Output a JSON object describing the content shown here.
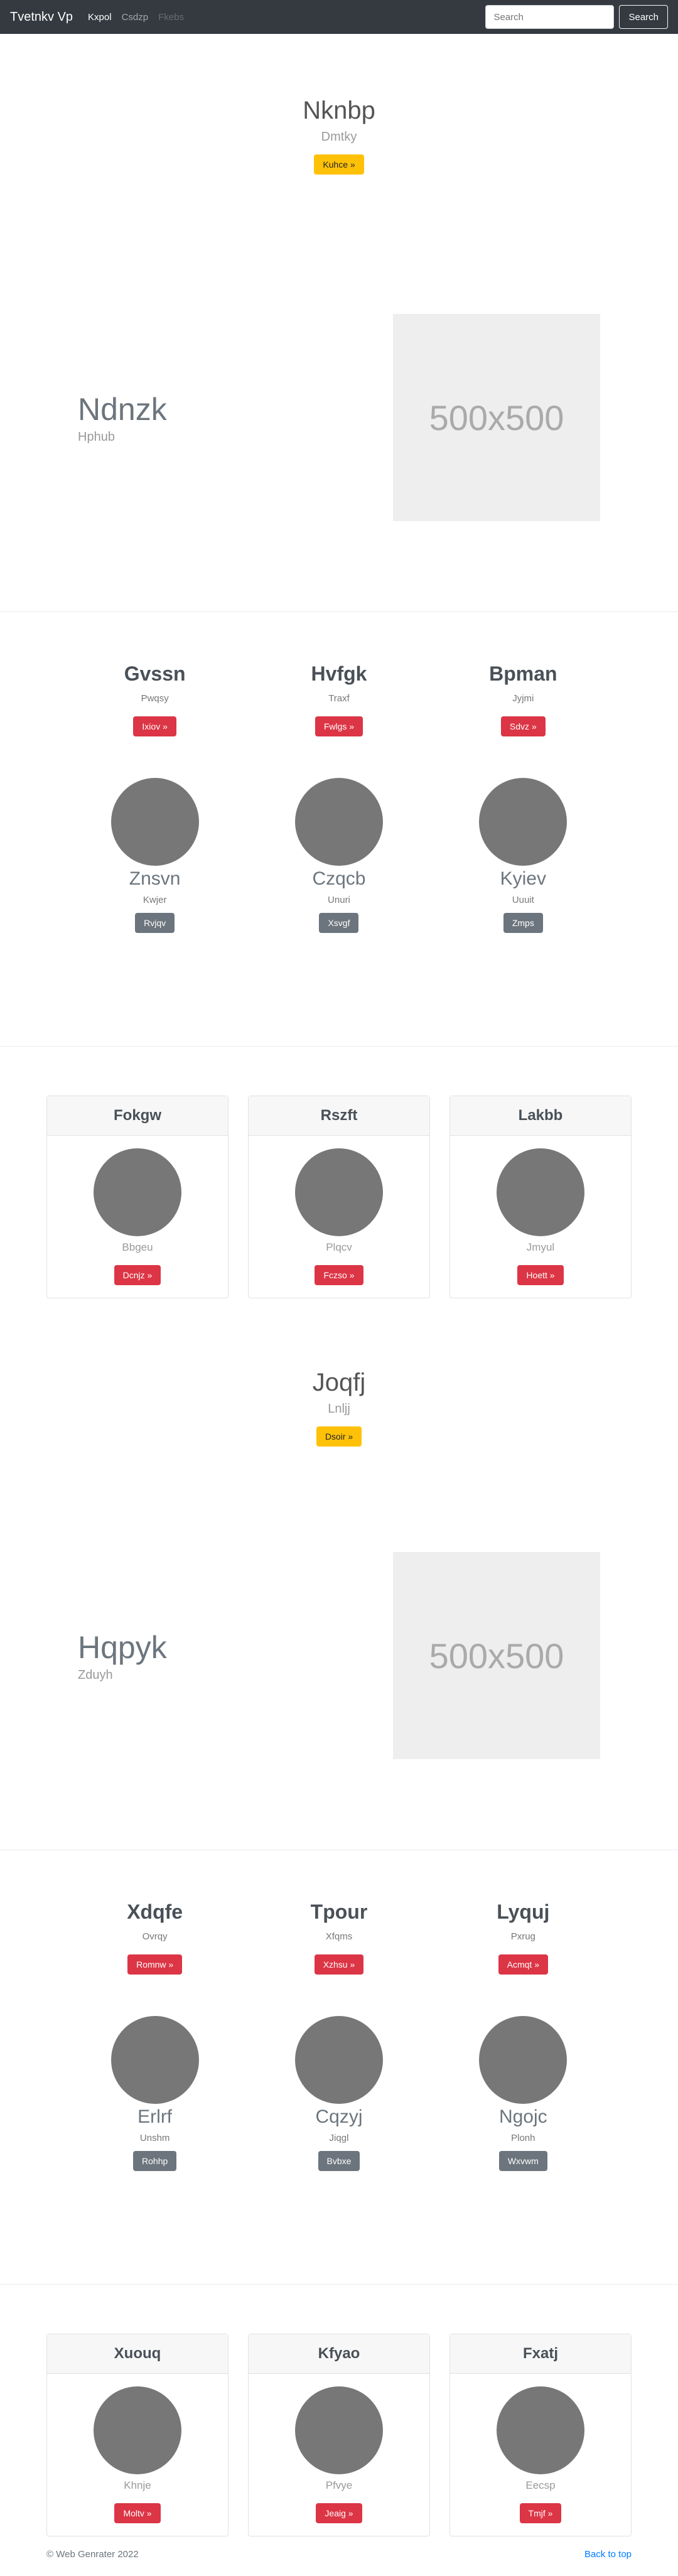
{
  "navbar": {
    "brand": "Tvetnkv Vp",
    "links": [
      "Kxpol",
      "Csdzp",
      "Fkebs"
    ],
    "search_placeholder": "Search",
    "search_button": "Search"
  },
  "hero1": {
    "title": "Nknbp",
    "lead": "Dmtky",
    "button": "Kuhce »"
  },
  "feature1": {
    "title": "Ndnzk",
    "sub": "Hphub",
    "image_label": "500x500"
  },
  "cols1": [
    {
      "title": "Gvssn",
      "text": "Pwqsy",
      "button": "Ixiov »"
    },
    {
      "title": "Hvfgk",
      "text": "Traxf",
      "button": "Fwlgs »"
    },
    {
      "title": "Bpman",
      "text": "Jyjmi",
      "button": "Sdvz »"
    }
  ],
  "circles1": [
    {
      "name": "Znsvn",
      "sub": "Kwjer",
      "button": "Rvjqv"
    },
    {
      "name": "Czqcb",
      "sub": "Unuri",
      "button": "Xsvgf"
    },
    {
      "name": "Kyiev",
      "sub": "Uuuit",
      "button": "Zmps"
    }
  ],
  "cards1": [
    {
      "header": "Fokgw",
      "sub": "Bbgeu",
      "button": "Dcnjz »"
    },
    {
      "header": "Rszft",
      "sub": "Plqcv",
      "button": "Fczso »"
    },
    {
      "header": "Lakbb",
      "sub": "Jmyul",
      "button": "Hoett »"
    }
  ],
  "hero2": {
    "title": "Joqfj",
    "lead": "Lnljj",
    "button": "Dsoir »"
  },
  "feature2": {
    "title": "Hqpyk",
    "sub": "Zduyh",
    "image_label": "500x500"
  },
  "cols2": [
    {
      "title": "Xdqfe",
      "text": "Ovrqy",
      "button": "Romnw »"
    },
    {
      "title": "Tpour",
      "text": "Xfqms",
      "button": "Xzhsu »"
    },
    {
      "title": "Lyquj",
      "text": "Pxrug",
      "button": "Acmqt »"
    }
  ],
  "circles2": [
    {
      "name": "Erlrf",
      "sub": "Unshm",
      "button": "Rohhp"
    },
    {
      "name": "Cqzyj",
      "sub": "Jiqgl",
      "button": "Bvbxe"
    },
    {
      "name": "Ngojc",
      "sub": "Plonh",
      "button": "Wxvwm"
    }
  ],
  "cards2": [
    {
      "header": "Xuouq",
      "sub": "Khnje",
      "button": "Moltv »"
    },
    {
      "header": "Kfyao",
      "sub": "Pfvye",
      "button": "Jeaig »"
    },
    {
      "header": "Fxatj",
      "sub": "Eecsp",
      "button": "Tmjf »"
    }
  ],
  "footer": {
    "copyright": "© Web Genrater 2022",
    "back_to_top": "Back to top"
  }
}
